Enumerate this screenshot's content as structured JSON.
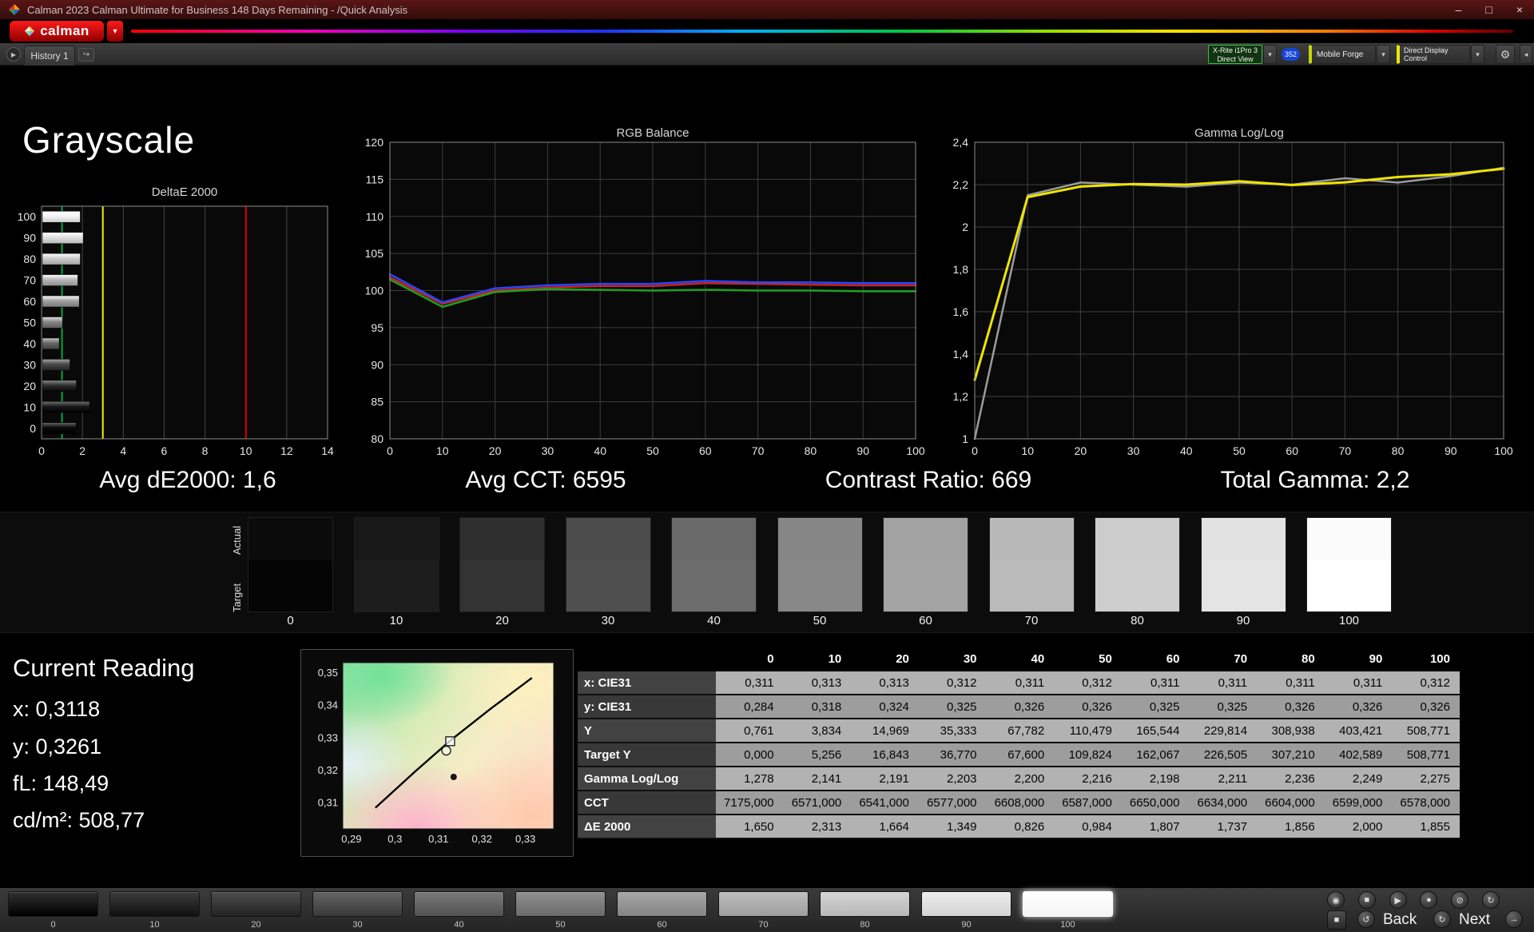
{
  "titlebar": {
    "title": "Calman 2023 Calman Ultimate for Business 148 Days Remaining - /Quick Analysis"
  },
  "window_controls": {
    "minimize": "–",
    "maximize": "□",
    "close": "×"
  },
  "menubar": {
    "logo_text": "calman"
  },
  "toolbar": {
    "history_tab": "History 1",
    "meter": {
      "line1": "X-Rite i1Pro 3",
      "line2": "Direct View"
    },
    "badge": "352",
    "source": "Mobile Forge",
    "display": "Direct Display Control"
  },
  "page_title": "Grayscale",
  "summary": {
    "avg_de": "Avg dE2000: 1,6",
    "avg_cct": "Avg CCT: 6595",
    "contrast": "Contrast Ratio: 669",
    "total_gamma": "Total Gamma: 2,2"
  },
  "current_reading": {
    "heading": "Current Reading",
    "x": "x: 0,3118",
    "y": "y: 0,3261",
    "fl": "fL: 148,49",
    "cdm2": "cd/m²: 508,77"
  },
  "strip_labels": {
    "actual": "Actual",
    "target": "Target"
  },
  "grayscale_swatches": {
    "levels": [
      "0",
      "10",
      "20",
      "30",
      "40",
      "50",
      "60",
      "70",
      "80",
      "90",
      "100"
    ],
    "actual": [
      "#0b0b0b",
      "#181818",
      "#2f2f2f",
      "#4b4b4b",
      "#696969",
      "#868686",
      "#a2a2a2",
      "#b8b8b8",
      "#cccccc",
      "#e2e2e2",
      "#fbfbfb"
    ],
    "target": [
      "#050505",
      "#1d1d1d",
      "#333333",
      "#4f4f4f",
      "#6c6c6c",
      "#888888",
      "#a4a4a4",
      "#bababa",
      "#cecece",
      "#e4e4e4",
      "#ffffff"
    ]
  },
  "chart_data": [
    {
      "type": "bar",
      "title": "DeltaE 2000",
      "orientation": "horizontal",
      "categories": [
        "100",
        "90",
        "80",
        "70",
        "60",
        "50",
        "40",
        "30",
        "20",
        "10",
        "0"
      ],
      "values": [
        1.855,
        2.0,
        1.856,
        1.737,
        1.807,
        0.984,
        0.826,
        1.349,
        1.664,
        2.313,
        1.65
      ],
      "bar_colors": [
        "#f4f4f4",
        "#e0e0e0",
        "#cbcbcb",
        "#b7b7b7",
        "#a1a1a1",
        "#858585",
        "#686868",
        "#4a4a4a",
        "#2e2e2e",
        "#181818",
        "#0a0a0a"
      ],
      "xlim": [
        0,
        14
      ],
      "xticks": [
        0,
        2,
        4,
        6,
        8,
        10,
        12,
        14
      ],
      "ref_lines": [
        {
          "x": 1.0,
          "color": "#00a844",
          "label": "average"
        },
        {
          "x": 3,
          "color": "#f0f000",
          "label": "warning"
        },
        {
          "x": 10,
          "color": "#e00000",
          "label": "fail"
        }
      ]
    },
    {
      "type": "line",
      "title": "RGB Balance",
      "x": [
        0,
        10,
        20,
        30,
        40,
        50,
        60,
        70,
        80,
        90,
        100
      ],
      "ylim": [
        80,
        120
      ],
      "yticks": [
        80,
        85,
        90,
        95,
        100,
        105,
        110,
        115,
        120
      ],
      "ytick_labels": [
        "80",
        "85",
        "90",
        "95",
        "100",
        "105",
        "110",
        "115",
        "120"
      ],
      "xticks": [
        0,
        10,
        20,
        30,
        40,
        50,
        60,
        70,
        80,
        90,
        100
      ],
      "series": [
        {
          "name": "Red",
          "color": "#cc2222",
          "values": [
            101.8,
            98.2,
            100.0,
            100.4,
            100.6,
            100.6,
            101.0,
            100.9,
            100.8,
            100.7,
            100.7
          ]
        },
        {
          "name": "Green",
          "color": "#1fa01f",
          "values": [
            101.5,
            97.8,
            99.8,
            100.2,
            100.1,
            100.0,
            100.1,
            100.0,
            100.0,
            99.9,
            99.9
          ]
        },
        {
          "name": "Blue",
          "color": "#2a46ff",
          "values": [
            102.2,
            98.4,
            100.3,
            100.7,
            100.9,
            100.9,
            101.3,
            101.1,
            101.1,
            101.0,
            101.0
          ]
        }
      ]
    },
    {
      "type": "line",
      "title": "Gamma Log/Log",
      "x": [
        0,
        10,
        20,
        30,
        40,
        50,
        60,
        70,
        80,
        90,
        100
      ],
      "ylim": [
        1,
        2.4
      ],
      "yticks": [
        1,
        1.2,
        1.4,
        1.6,
        1.8,
        2,
        2.2,
        2.4
      ],
      "ytick_labels": [
        "1",
        "1,2",
        "1,4",
        "1,6",
        "1,8",
        "2",
        "2,2",
        "2,4"
      ],
      "xticks": [
        0,
        10,
        20,
        30,
        40,
        50,
        60,
        70,
        80,
        90,
        100
      ],
      "series": [
        {
          "name": "Reference",
          "color": "#9b9b9b",
          "values": [
            1.0,
            2.15,
            2.21,
            2.2,
            2.19,
            2.21,
            2.2,
            2.23,
            2.21,
            2.24,
            2.28
          ]
        },
        {
          "name": "Measured",
          "color": "#efe400",
          "values": [
            1.278,
            2.141,
            2.191,
            2.203,
            2.2,
            2.216,
            2.198,
            2.211,
            2.236,
            2.249,
            2.275
          ]
        }
      ]
    },
    {
      "type": "scatter",
      "title": "CIE chromaticity",
      "xlim": [
        0.288,
        0.3365
      ],
      "ylim": [
        0.302,
        0.3532
      ],
      "xticks": [
        0.29,
        0.3,
        0.31,
        0.32,
        0.33
      ],
      "xtick_labels": [
        "0,29",
        "0,3",
        "0,31",
        "0,32",
        "0,33"
      ],
      "yticks": [
        0.35,
        0.34,
        0.33,
        0.32,
        0.31
      ],
      "ytick_labels": [
        "0,35",
        "0,34",
        "0,33",
        "0,32",
        "0,31"
      ],
      "locus": [
        [
          0.2955,
          0.3085
        ],
        [
          0.3045,
          0.3195
        ],
        [
          0.313,
          0.3295
        ],
        [
          0.322,
          0.339
        ],
        [
          0.3315,
          0.3485
        ]
      ],
      "markers": [
        {
          "shape": "square",
          "x": 0.3127,
          "y": 0.329
        },
        {
          "shape": "circle",
          "x": 0.3118,
          "y": 0.3261
        },
        {
          "shape": "dot",
          "x": 0.3135,
          "y": 0.318
        }
      ]
    }
  ],
  "table": {
    "columns": [
      "0",
      "10",
      "20",
      "30",
      "40",
      "50",
      "60",
      "70",
      "80",
      "90",
      "100"
    ],
    "rows": [
      {
        "label": "x: CIE31",
        "values": [
          "0,311",
          "0,313",
          "0,313",
          "0,312",
          "0,311",
          "0,312",
          "0,311",
          "0,311",
          "0,311",
          "0,311",
          "0,312"
        ]
      },
      {
        "label": "y: CIE31",
        "values": [
          "0,284",
          "0,318",
          "0,324",
          "0,325",
          "0,326",
          "0,326",
          "0,325",
          "0,325",
          "0,326",
          "0,326",
          "0,326"
        ]
      },
      {
        "label": "Y",
        "values": [
          "0,761",
          "3,834",
          "14,969",
          "35,333",
          "67,782",
          "110,479",
          "165,544",
          "229,814",
          "308,938",
          "403,421",
          "508,771"
        ]
      },
      {
        "label": "Target Y",
        "values": [
          "0,000",
          "5,256",
          "16,843",
          "36,770",
          "67,600",
          "109,824",
          "162,067",
          "226,505",
          "307,210",
          "402,589",
          "508,771"
        ]
      },
      {
        "label": "Gamma Log/Log",
        "values": [
          "1,278",
          "2,141",
          "2,191",
          "2,203",
          "2,200",
          "2,216",
          "2,198",
          "2,211",
          "2,236",
          "2,249",
          "2,275"
        ]
      },
      {
        "label": "CCT",
        "values": [
          "7175,000",
          "6571,000",
          "6541,000",
          "6577,000",
          "6608,000",
          "6587,000",
          "6650,000",
          "6634,000",
          "6604,000",
          "6599,000",
          "6578,000"
        ]
      },
      {
        "label": "ΔE 2000",
        "values": [
          "1,650",
          "2,313",
          "1,664",
          "1,349",
          "0,826",
          "0,984",
          "1,807",
          "1,737",
          "1,856",
          "2,000",
          "1,855"
        ]
      }
    ]
  },
  "bottom_bar": {
    "levels": [
      {
        "label": "0",
        "from": "#303030",
        "to": "#000000"
      },
      {
        "label": "10",
        "from": "#3c3c3c",
        "to": "#101010"
      },
      {
        "label": "20",
        "from": "#4e4e4e",
        "to": "#222222"
      },
      {
        "label": "30",
        "from": "#636363",
        "to": "#3a3a3a"
      },
      {
        "label": "40",
        "from": "#7a7a7a",
        "to": "#525252"
      },
      {
        "label": "50",
        "from": "#909090",
        "to": "#6a6a6a"
      },
      {
        "label": "60",
        "from": "#a7a7a7",
        "to": "#848484"
      },
      {
        "label": "70",
        "from": "#bebebe",
        "to": "#9e9e9e"
      },
      {
        "label": "80",
        "from": "#d4d4d4",
        "to": "#b8b8b8"
      },
      {
        "label": "90",
        "from": "#ebebeb",
        "to": "#d4d4d4"
      },
      {
        "label": "100",
        "from": "#ffffff",
        "to": "#f4f4f4"
      }
    ],
    "selected": "100",
    "back": "Back",
    "next": "Next"
  },
  "icons": {
    "gem": "◆",
    "dropdown": "▾",
    "history_play": "▶",
    "history_new": "↪",
    "gear": "⚙",
    "edge": "◂",
    "measure_1": "◉",
    "measure_2": "■",
    "measure_3": "▶",
    "measure_4": "●",
    "measure_5": "⊘",
    "measure_6": "↻",
    "stop_square": "■",
    "back_circle": "↺",
    "next_circle": "↻",
    "go_circle": "→"
  }
}
